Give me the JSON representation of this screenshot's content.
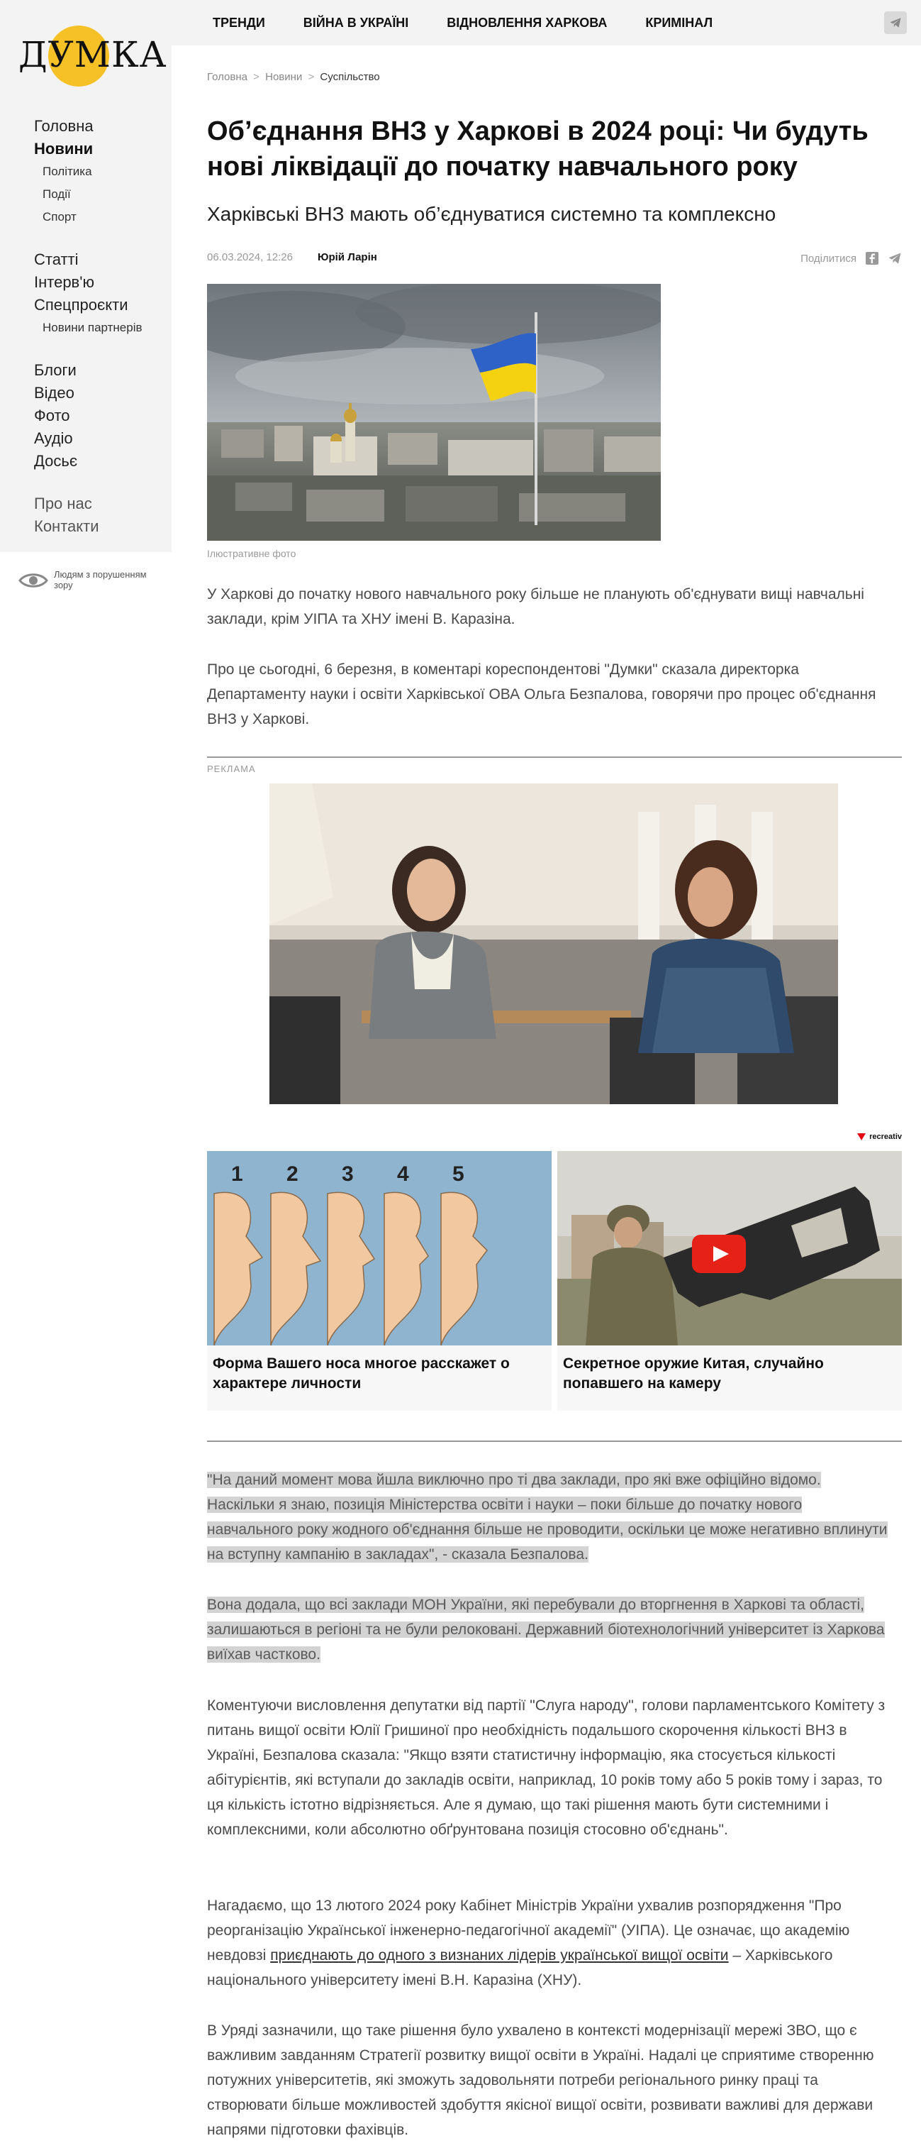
{
  "topnav": {
    "items": [
      "ТРЕНДИ",
      "ВІЙНА В УКРАЇНІ",
      "ВІДНОВЛЕННЯ ХАРКОВА",
      "КРИМІНАЛ"
    ],
    "telegram_icon": "telegram-icon"
  },
  "logo": {
    "text": "ДУМКА",
    "color": "#f6c126"
  },
  "sidebar": {
    "group1": {
      "main1": "Головна",
      "main2": "Новини",
      "sub1": "Політика",
      "sub2": "Події",
      "sub3": "Спорт"
    },
    "group2": {
      "main1": "Статті",
      "main2": "Інтерв'ю",
      "main3": "Спецпроєкти",
      "sub1": "Новини партнерів"
    },
    "group3": {
      "main1": "Блоги",
      "main2": "Відео",
      "main3": "Фото",
      "main4": "Аудіо",
      "main5": "Досьє"
    },
    "group4": {
      "main1": "Про нас",
      "main2": "Контакти"
    },
    "accessibility": "Людям з порушенням зору"
  },
  "breadcrumb": {
    "home": "Головна",
    "news": "Новини",
    "current": "Суспільство",
    "separator": ">"
  },
  "article": {
    "title": "Об’єднання ВНЗ у Харкові в 2024 році: Чи будуть нові ліквідації до початку навчального року",
    "subtitle": "Харківські ВНЗ мають об’єднуватися системно та комплексно",
    "date": "06.03.2024, 12:26",
    "author": "Юрій Ларін",
    "share_label": "Поділитися",
    "image_caption": "Ілюстративне фото",
    "p1": "У Харкові до початку нового навчального року більше не планують об'єднувати вищі навчальні заклади, крім УІПА та ХНУ імені В. Каразіна.",
    "p2": "Про це сьогодні, 6 березня, в коментарі кореспондентові \"Думки\" сказала директорка Департаменту науки і освіти Харківської ОВА Ольга Безпалова, говорячи про процес об'єднання ВНЗ у Харкові.",
    "p3": "\"На даний момент мова йшла виключно про ті два заклади, про які вже офіційно відомо. Наскільки я знаю, позиція Міністерства освіти і науки – поки більше до початку нового навчального року жодного об'єднання більше не проводити, оскільки це може негативно вплинути на вступну кампанію в закладах\", - сказала Безпалова.",
    "p4": "Вона додала, що всі заклади МОН України, які перебували до вторгнення в Харкові та області, залишаються в регіоні та не були релоковані. Державний біотехнологічний університет із Харкова виїхав частково.",
    "p5": "Коментуючи висловлення депутатки від партії \"Слуга народу\", голови парламентського Комітету з питань вищої освіти Юлії Гришиної про необхідність подальшого скорочення кількості ВНЗ в Україні, Безпалова сказала: \"Якщо взяти статистичну інформацію, яка стосується кількості абітурієнтів, які вступали до закладів освіти, наприклад, 10 років тому або 5 років тому і зараз, то ця кількість істотно відрізняється. Але я думаю, що такі рішення мають бути системними і комплексними, коли абсолютно обґрунтована позиція стосовно об'єднань\".",
    "p6_start": "Нагадаємо, що 13 лютого 2024 року Кабінет Міністрів України ухвалив розпорядження \"Про реорганізацію Української інженерно-педагогічної академії\" (УІПА). Це означає, що академію невдовзі ",
    "p6_link": "приєднають до одного з визнаних лідерів української вищої освіти",
    "p6_end": " – Харківського національного університету імені В.Н. Каразіна (ХНУ).",
    "p7": "В Уряді зазначили, що таке рішення було ухвалено в контексті модернізації мережі ЗВО, що є важливим завданням Стратегії розвитку вищої освіти в Україні. Надалі це сприятиме створенню потужних університетів, які зможуть задовольняти потреби регіонального ринку праці та створювати більше можливостей здобуття якісної вищої освіти, розвивати важливі для держави напрями підготовки фахівців."
  },
  "ad": {
    "label": "РЕКЛАМА",
    "network": "recreativ",
    "card1_title": "Форма Вашего носа многое расскажет о характере личности",
    "card2_title": "Секретное оружие Китая, случайно попавшего на камеру",
    "nose_numbers": [
      "1",
      "2",
      "3",
      "4",
      "5"
    ]
  },
  "colors": {
    "accent": "#f6c126",
    "highlight": "#d3d3d3",
    "nav_bg": "#f3f3f3",
    "youtube": "#e62117",
    "flag_blue": "#2f62c6",
    "flag_yellow": "#f5d211"
  }
}
